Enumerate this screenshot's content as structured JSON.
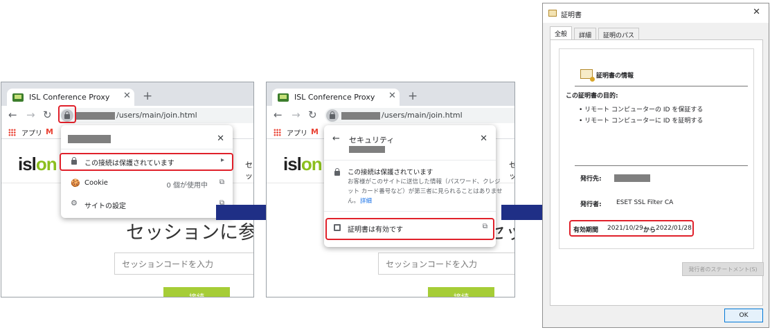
{
  "browser": {
    "tab_title": "ISL Conference Proxy",
    "tab_close": "✕",
    "new_tab": "+",
    "url_path": "/users/main/join.html",
    "bookmarks": {
      "apps_label": "アプリ",
      "gmail_glyph": "M"
    },
    "nav": {
      "back": "←",
      "forward": "→",
      "reload": "↻"
    }
  },
  "page": {
    "logo_prefix": "isl",
    "logo_accent": "on",
    "nav_fragment": "セッ",
    "session_title": "セッションに参加",
    "session_input_placeholder": "セッションコードを入力",
    "join_label": "接続"
  },
  "popup1": {
    "close": "✕",
    "rows": [
      {
        "label": "この接続は保護されています",
        "right": "",
        "trail": "▸"
      },
      {
        "label": "Cookie",
        "right": "0 個が使用中",
        "trail": "⧉"
      },
      {
        "label": "サイトの設定",
        "right": "",
        "trail": "⧉"
      }
    ]
  },
  "popup2": {
    "back": "←",
    "title": "セキュリティ",
    "close": "✕",
    "secure_heading": "この接続は保護されています",
    "secure_desc_1": "お客様がこのサイトに送信した情報（パスワード、クレジ",
    "secure_desc_2": "ット カード番号など）が第三者に見られることはありませ",
    "secure_desc_3": "ん。",
    "details_link": "詳細",
    "cert_row": "証明書は有効です",
    "cert_trail": "⧉"
  },
  "cert_dialog": {
    "title": "証明書",
    "close": "✕",
    "tabs": [
      "全般",
      "詳細",
      "証明のパス"
    ],
    "heading": "証明書の情報",
    "purpose_label": "この証明書の目的:",
    "purposes": [
      "• リモート コンピューターの ID を保証する",
      "• リモート コンピューターに ID を証明する"
    ],
    "issued_to_label": "発行先:",
    "issued_by_label": "発行者:",
    "issued_by_value": "ESET SSL Filter CA",
    "validity_label": "有効期間",
    "valid_from": "2021/10/29",
    "from_word": "から",
    "valid_to": "2022/01/28",
    "statement_button": "発行者のステートメント(S)",
    "ok_button": "OK"
  },
  "colors": {
    "highlight": "#e0202a",
    "arrow": "#1f2f86",
    "brand_green": "#8cbf1e",
    "join_button": "#a6cd37"
  }
}
